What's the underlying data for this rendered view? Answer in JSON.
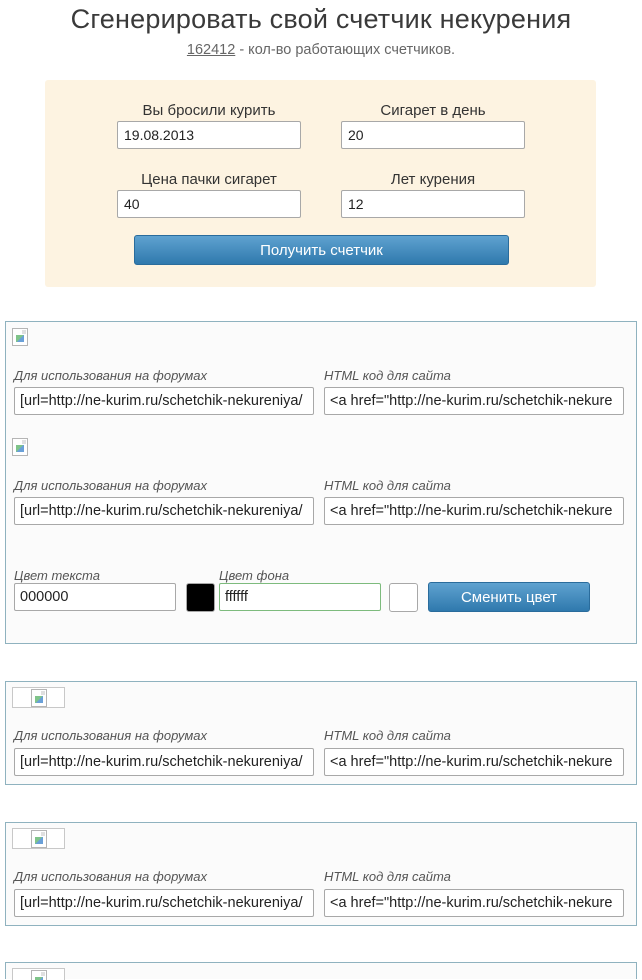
{
  "header": {
    "title": "Сгенерировать свой счетчик некурения",
    "counter_value": "162412",
    "counter_text": " - кол-во работающих счетчиков."
  },
  "form": {
    "quit_date_label": "Вы бросили курить",
    "quit_date_value": "19.08.2013",
    "cigs_per_day_label": "Сигарет в день",
    "cigs_per_day_value": "20",
    "pack_price_label": "Цена пачки сигарет",
    "pack_price_value": "40",
    "years_label": "Лет курения",
    "years_value": "12",
    "submit_label": "Получить счетчик"
  },
  "panels": [
    {
      "codes": [
        {
          "forum_label": "Для использования на форумах",
          "forum_value": "[url=http://ne-kurim.ru/schetchik-nekureniya/",
          "html_label": "HTML код для сайта",
          "html_value": "<a href=\"http://ne-kurim.ru/schetchik-nekure"
        },
        {
          "forum_label": "Для использования на форумах",
          "forum_value": "[url=http://ne-kurim.ru/schetchik-nekureniya/",
          "html_label": "HTML код для сайта",
          "html_value": "<a href=\"http://ne-kurim.ru/schetchik-nekure"
        }
      ],
      "colors": {
        "text_color_label": "Цвет текста",
        "text_color_value": "000000",
        "text_swatch": "#000000",
        "bg_color_label": "Цвет фона",
        "bg_color_value": "ffffff",
        "bg_swatch": "#ffffff",
        "change_label": "Сменить цвет"
      }
    },
    {
      "forum_label": "Для использования на форумах",
      "forum_value": "[url=http://ne-kurim.ru/schetchik-nekureniya/",
      "html_label": "HTML код для сайта",
      "html_value": "<a href=\"http://ne-kurim.ru/schetchik-nekure"
    },
    {
      "forum_label": "Для использования на форумах",
      "forum_value": "[url=http://ne-kurim.ru/schetchik-nekureniya/",
      "html_label": "HTML код для сайта",
      "html_value": "<a href=\"http://ne-kurim.ru/schetchik-nekure"
    }
  ]
}
